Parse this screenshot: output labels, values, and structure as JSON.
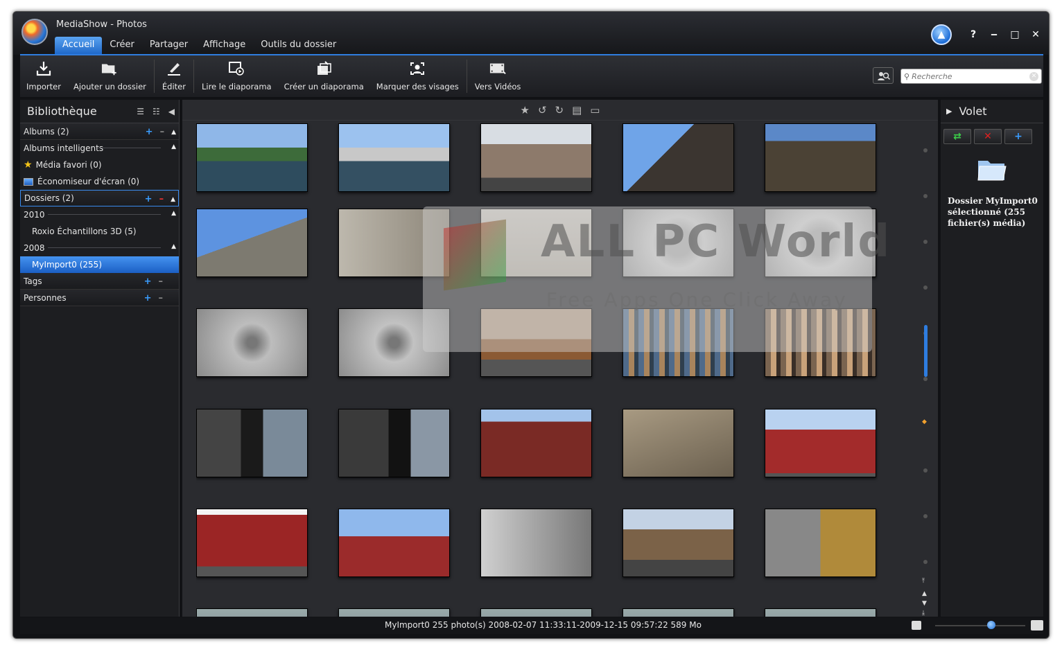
{
  "window": {
    "title": "MediaShow - Photos"
  },
  "menu": {
    "tabs": [
      "Accueil",
      "Créer",
      "Partager",
      "Affichage",
      "Outils du dossier"
    ],
    "active": 0
  },
  "win_buttons": {
    "help": "?",
    "minimize": "‒",
    "maximize": "□",
    "close": "✕"
  },
  "ribbon": {
    "buttons": [
      {
        "label": "Importer",
        "icon": "import-icon"
      },
      {
        "label": "Ajouter un dossier",
        "icon": "add-folder-icon"
      },
      {
        "label": "Éditer",
        "icon": "edit-icon"
      },
      {
        "label": "Lire le diaporama",
        "icon": "play-slideshow-icon"
      },
      {
        "label": "Créer un diaporama",
        "icon": "create-slideshow-icon"
      },
      {
        "label": "Marquer des visages",
        "icon": "face-tag-icon"
      },
      {
        "label": "Vers Vidéos",
        "icon": "to-videos-icon"
      }
    ]
  },
  "search": {
    "placeholder": "Recherche",
    "value": ""
  },
  "library": {
    "title": "Bibliothèque",
    "albums": "Albums (2)",
    "smart_albums": "Albums intelligents",
    "favorites": "Média favori (0)",
    "screensaver": "Économiseur d'écran (0)",
    "folders": "Dossiers (2)",
    "year_2010": "2010",
    "roxio": "Roxio Échantillons 3D (5)",
    "year_2008": "2008",
    "myimport": "MyImport0 (255)",
    "tags": "Tags",
    "people": "Personnes"
  },
  "panel": {
    "title": "Volet",
    "description": "Dossier MyImport0 sélectionné (255 fichier(s) média)"
  },
  "status": {
    "text": "MyImport0  255 photo(s)  2008-02-07 11:33:11-2009-12-15 09:57:22  589 Mo",
    "zoom_level": 0.62
  },
  "watermark": {
    "title": "ALL PC World",
    "subtitle": "Free Apps One Click Away"
  },
  "thumbnails": [
    "river-canal",
    "river-bridge",
    "street-buildings",
    "palace-low-angle",
    "colonnade",
    "tower-tilted",
    "wall-letters",
    "stamp-closeup",
    "stone-rosette",
    "stone-rosette-2",
    "stone-medallion",
    "stone-medallion-2",
    "horse-carriage",
    "t-shirts-display",
    "t-shirts-display-2",
    "traffic-light-red",
    "traffic-light-green",
    "red-wall-text",
    "aerial-city",
    "checkpoint-charlie-banner",
    "exhibit-panels",
    "checkpoint-charlie-wall",
    "sign-american-sector",
    "tourists-exhibit",
    "old-car-photo"
  ]
}
